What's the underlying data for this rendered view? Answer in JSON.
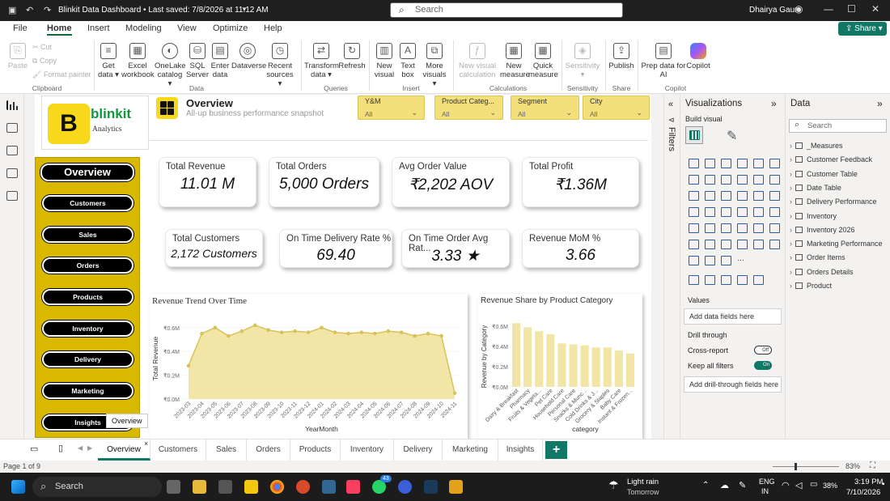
{
  "app": {
    "title": "Blinkit Data Dashboard • Last saved: 7/8/2026 at 11:12 AM",
    "search_placeholder": "Search",
    "user": "Dhairya Gaur"
  },
  "menu": [
    "File",
    "Home",
    "Insert",
    "Modeling",
    "View",
    "Optimize",
    "Help"
  ],
  "share_label": "Share",
  "ribbon": {
    "clipboard": {
      "paste": "Paste",
      "cut": "Cut",
      "copy": "Copy",
      "format_painter": "Format painter",
      "group": "Clipboard"
    },
    "data": {
      "get_data": [
        "Get",
        "data"
      ],
      "excel": [
        "Excel",
        "workbook"
      ],
      "onelake": [
        "OneLake",
        "catalog"
      ],
      "sql": [
        "SQL",
        "Server"
      ],
      "enter": [
        "Enter",
        "data"
      ],
      "dataverse": [
        "Dataverse",
        ""
      ],
      "recent": [
        "Recent",
        "sources"
      ],
      "group": "Data"
    },
    "queries": {
      "transform": [
        "Transform",
        "data"
      ],
      "refresh": [
        "Refresh",
        ""
      ],
      "group": "Queries"
    },
    "insert": {
      "new_visual": [
        "New",
        "visual"
      ],
      "text_box": [
        "Text",
        "box"
      ],
      "more_visuals": [
        "More",
        "visuals"
      ],
      "group": "Insert"
    },
    "calculations": {
      "new_visual_calc": [
        "New visual",
        "calculation"
      ],
      "new_measure": [
        "New",
        "measure"
      ],
      "quick_measure": [
        "Quick",
        "measure"
      ],
      "group": "Calculations"
    },
    "sensitivity": {
      "label": [
        "Sensitivity",
        ""
      ],
      "group": "Sensitivity"
    },
    "share": {
      "publish": [
        "Publish",
        ""
      ],
      "group": "Share"
    },
    "copilot": {
      "prep": [
        "Prep data for",
        "AI"
      ],
      "copilot": [
        "Copilot",
        ""
      ],
      "group": "Copilot"
    }
  },
  "header": {
    "logo_letter": "B",
    "logo_text": "blinkit",
    "logo_sub": "Analytics",
    "title": "Overview",
    "subtitle": "All-up business performance snapshot"
  },
  "slicers": [
    {
      "label": "Y&M",
      "value": "All"
    },
    {
      "label": "Product Categ...",
      "value": "All"
    },
    {
      "label": "Segment",
      "value": "All"
    },
    {
      "label": "City",
      "value": "All"
    }
  ],
  "nav": [
    "Overview",
    "Customers",
    "Sales",
    "Orders",
    "Products",
    "Inventory",
    "Delivery",
    "Marketing",
    "Insights"
  ],
  "tooltip": "Overview",
  "kpis": [
    {
      "label": "Total Revenue",
      "value": "11.01 M"
    },
    {
      "label": "Total Orders",
      "value": "5,000 Orders"
    },
    {
      "label": "Avg Order Value",
      "value": "₹2,202 AOV"
    },
    {
      "label": "Total Profit",
      "value": "₹1.36M"
    },
    {
      "label": "Total Customers",
      "value": "2,172 Customers"
    },
    {
      "label": "On Time Delivery Rate %",
      "value": "69.40"
    },
    {
      "label": "On Time Order Avg Rat...",
      "value": "3.33 ★"
    },
    {
      "label": "Revenue MoM %",
      "value": "3.66"
    }
  ],
  "chart_data": [
    {
      "type": "area",
      "title": "Revenue Trend Over Time",
      "xlabel": "YearMonth",
      "ylabel": "Total Revenue",
      "x": [
        "2023-03",
        "2023-04",
        "2023-05",
        "2023-06",
        "2023-07",
        "2023-08",
        "2023-09",
        "2023-10",
        "2023-11",
        "2023-12",
        "2024-01",
        "2024-02",
        "2024-03",
        "2024-04",
        "2024-05",
        "2024-06",
        "2024-07",
        "2024-08",
        "2024-09",
        "2024-10",
        "2024-11"
      ],
      "values": [
        0.28,
        0.55,
        0.6,
        0.53,
        0.57,
        0.62,
        0.58,
        0.56,
        0.57,
        0.56,
        0.6,
        0.56,
        0.55,
        0.56,
        0.55,
        0.57,
        0.56,
        0.53,
        0.55,
        0.53,
        0.05
      ],
      "yticks": [
        "₹0.0M",
        "₹0.2M",
        "₹0.4M",
        "₹0.6M"
      ],
      "ylim": [
        0,
        0.68
      ],
      "color": "#f2e6a6",
      "line_color": "#d8c25a"
    },
    {
      "type": "bar",
      "title": "Revenue Share by Product Category",
      "xlabel": "category",
      "ylabel": "Revenue by Category",
      "categories": [
        "Dairy & Breakfast",
        "Pharmacy",
        "Fruits & Vegeta...",
        "Pet Care",
        "Household Care",
        "Personal Care",
        "Snacks & Munc...",
        "Cold Drinks & J...",
        "Grocery & Staples",
        "Baby Care",
        "Instant & Frozen..."
      ],
      "values": [
        0.63,
        0.59,
        0.55,
        0.52,
        0.43,
        0.42,
        0.41,
        0.39,
        0.39,
        0.36,
        0.33
      ],
      "yticks": [
        "₹0.0M",
        "₹0.2M",
        "₹0.4M",
        "₹0.6M"
      ],
      "ylim": [
        0,
        0.68
      ],
      "color": "#f2e6a6"
    }
  ],
  "tabs": [
    "Overview",
    "Customers",
    "Sales",
    "Orders",
    "Products",
    "Inventory",
    "Delivery",
    "Marketing",
    "Insights"
  ],
  "status": {
    "page": "Page 1 of 9",
    "zoom": "83%"
  },
  "panes": {
    "filters": "Filters",
    "viz_title": "Visualizations",
    "build_visual": "Build visual",
    "values_label": "Values",
    "add_fields": "Add data fields here",
    "drill_through": "Drill through",
    "cross_report": "Cross-report",
    "cross_state": "Off",
    "keep_filters": "Keep all filters",
    "keep_state": "On",
    "add_drill": "Add drill-through fields here",
    "data_title": "Data",
    "data_search": "Search",
    "tables": [
      "_Measures",
      "Customer Feedback",
      "Customer Table",
      "Date Table",
      "Delivery Performance",
      "Inventory",
      "Inventory 2026",
      "Marketing Performance",
      "Order Items",
      "Orders Details",
      "Product"
    ]
  },
  "taskbar": {
    "search": "Search",
    "weather": "Light rain",
    "weather_sub": "Tomorrow",
    "lang1": "ENG",
    "lang2": "IN",
    "battery": "38%",
    "time": "3:19 PM",
    "date": "7/10/2026",
    "badge": "43"
  }
}
